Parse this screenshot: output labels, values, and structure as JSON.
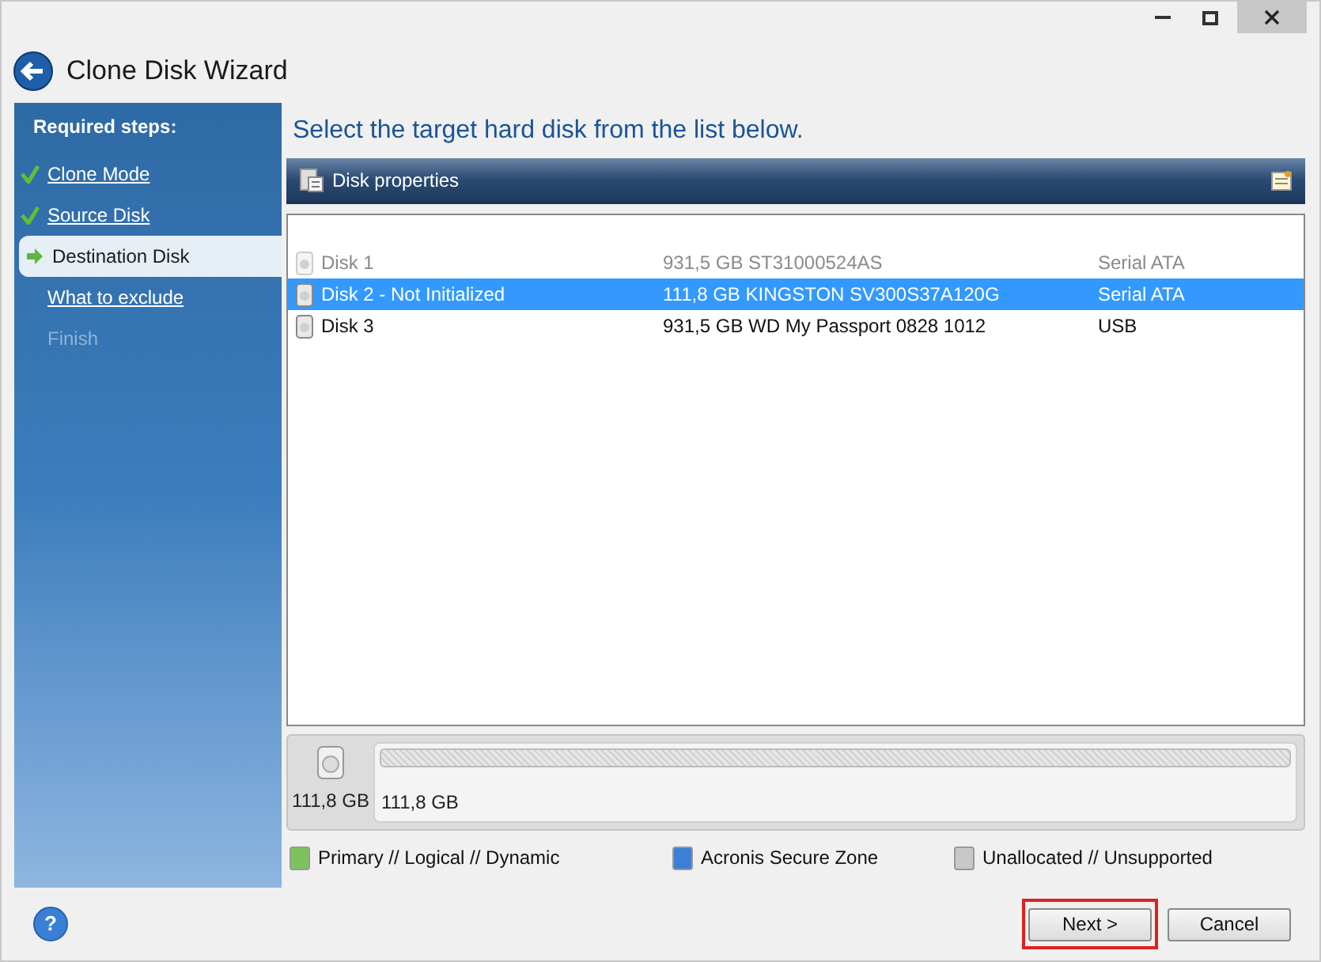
{
  "window": {
    "title": "Clone Disk Wizard"
  },
  "sidebar": {
    "heading": "Required steps:",
    "steps": [
      {
        "label": "Clone Mode",
        "done": true,
        "current": false,
        "disabled": false
      },
      {
        "label": "Source Disk",
        "done": true,
        "current": false,
        "disabled": false
      },
      {
        "label": "Destination Disk",
        "done": false,
        "current": true,
        "disabled": false
      },
      {
        "label": "What to exclude",
        "done": false,
        "current": false,
        "disabled": false
      },
      {
        "label": "Finish",
        "done": false,
        "current": false,
        "disabled": true
      }
    ]
  },
  "instruction": "Select the target hard disk from the list below.",
  "toolbar": {
    "label": "Disk properties"
  },
  "disks": [
    {
      "name": "Disk 1",
      "capacity": "931,5 GB ST31000524AS",
      "interface": "Serial ATA",
      "selected": false,
      "disabled": true
    },
    {
      "name": "Disk 2 - Not Initialized",
      "capacity": "111,8 GB KINGSTON SV300S37A120G",
      "interface": "Serial ATA",
      "selected": true,
      "disabled": false
    },
    {
      "name": "Disk 3",
      "capacity": "931,5 GB WD My Passport 0828 1012",
      "interface": "USB",
      "selected": false,
      "disabled": false
    }
  ],
  "disk_map": {
    "disk_size": "111,8 GB",
    "partitions": [
      {
        "kind": "unallocated",
        "label": "111,8 GB"
      }
    ]
  },
  "legend": [
    {
      "label": "Primary // Logical // Dynamic",
      "color": "#7cc45a"
    },
    {
      "label": "Acronis Secure Zone",
      "color": "#3c7fd6"
    },
    {
      "label": "Unallocated // Unsupported",
      "color": "#c8c8c8"
    }
  ],
  "help_button": "?",
  "buttons": [
    {
      "label": "Next >",
      "highlighted": true
    },
    {
      "label": "Cancel",
      "highlighted": false
    }
  ]
}
